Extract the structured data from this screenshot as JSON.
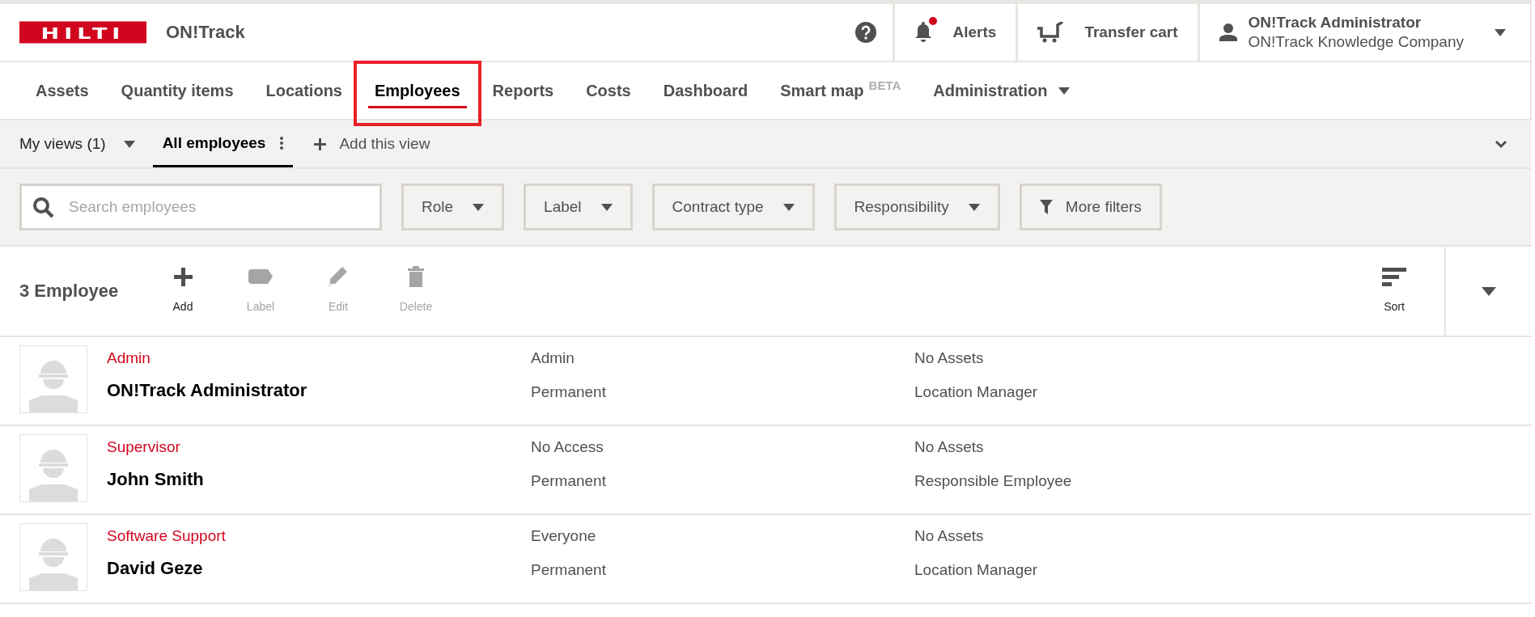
{
  "header": {
    "logo": "HILTI",
    "app_name": "ON!Track",
    "alerts": {
      "label": "Alerts",
      "unread": true
    },
    "transfer_cart": "Transfer cart",
    "user": {
      "name": "ON!Track Administrator",
      "company": "ON!Track Knowledge Company"
    }
  },
  "nav": {
    "tabs": [
      {
        "label": "Assets",
        "selected": false,
        "highlighted": false
      },
      {
        "label": "Quantity items",
        "selected": false,
        "highlighted": false
      },
      {
        "label": "Locations",
        "selected": false,
        "highlighted": false
      },
      {
        "label": "Employees",
        "selected": true,
        "highlighted": true
      },
      {
        "label": "Reports",
        "selected": false,
        "highlighted": false
      },
      {
        "label": "Costs",
        "selected": false,
        "highlighted": false
      },
      {
        "label": "Dashboard",
        "selected": false,
        "highlighted": false
      },
      {
        "label": "Smart map",
        "badge": "BETA",
        "selected": false,
        "highlighted": false
      },
      {
        "label": "Administration",
        "dropdown": true,
        "selected": false,
        "highlighted": false
      }
    ]
  },
  "views": {
    "my_views": "My views (1)",
    "tabs": [
      {
        "label": "All employees",
        "selected": true
      }
    ],
    "add_view": "Add this view"
  },
  "filters": {
    "search": {
      "placeholder": "Search employees"
    },
    "dropdowns": [
      "Role",
      "Label",
      "Contract type",
      "Responsibility"
    ],
    "more_filters": "More filters"
  },
  "toolbar": {
    "count": "3 Employee",
    "actions": [
      {
        "kind": "add",
        "label": "Add",
        "disabled": false
      },
      {
        "kind": "label",
        "label": "Label",
        "disabled": true
      },
      {
        "kind": "edit",
        "label": "Edit",
        "disabled": true
      },
      {
        "kind": "delete",
        "label": "Delete",
        "disabled": true
      }
    ],
    "sort": "Sort"
  },
  "employees": [
    {
      "role": "Admin",
      "name": "ON!Track Administrator",
      "access": "Admin",
      "contract": "Permanent",
      "assets": "No Assets",
      "responsibility": "Location Manager"
    },
    {
      "role": "Supervisor",
      "name": "John Smith",
      "access": "No Access",
      "contract": "Permanent",
      "assets": "No Assets",
      "responsibility": "Responsible Employee"
    },
    {
      "role": "Software Support",
      "name": "David Geze",
      "access": "Everyone",
      "contract": "Permanent",
      "assets": "No Assets",
      "responsibility": "Location Manager"
    }
  ]
}
